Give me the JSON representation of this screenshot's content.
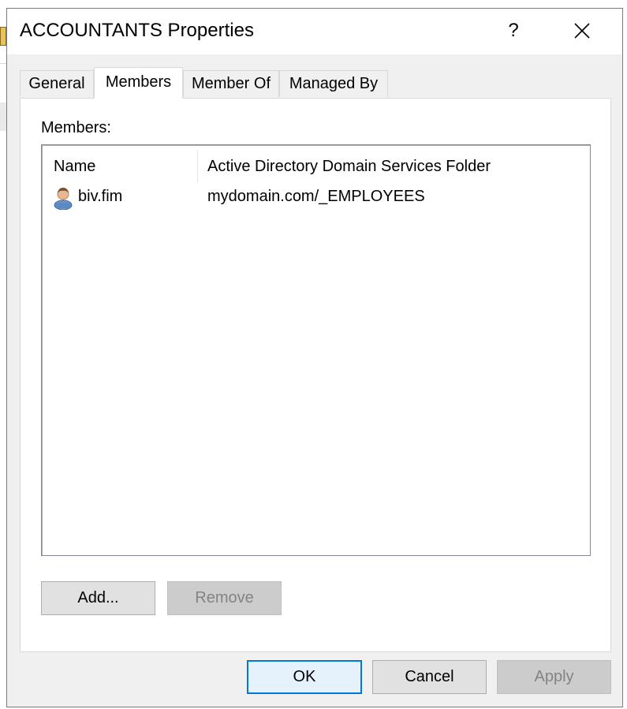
{
  "window": {
    "title": "ACCOUNTANTS Properties",
    "help_label": "?"
  },
  "tabs": [
    {
      "label": "General",
      "active": false
    },
    {
      "label": "Members",
      "active": true
    },
    {
      "label": "Member Of",
      "active": false
    },
    {
      "label": "Managed By",
      "active": false
    }
  ],
  "members": {
    "label": "Members:",
    "columns": [
      "Name",
      "Active Directory Domain Services Folder"
    ],
    "rows": [
      {
        "name": "biv.fim",
        "folder": "mydomain.com/_EMPLOYEES",
        "icon": "user-icon"
      }
    ],
    "add_label": "Add...",
    "remove_label": "Remove"
  },
  "footer": {
    "ok_label": "OK",
    "cancel_label": "Cancel",
    "apply_label": "Apply"
  }
}
